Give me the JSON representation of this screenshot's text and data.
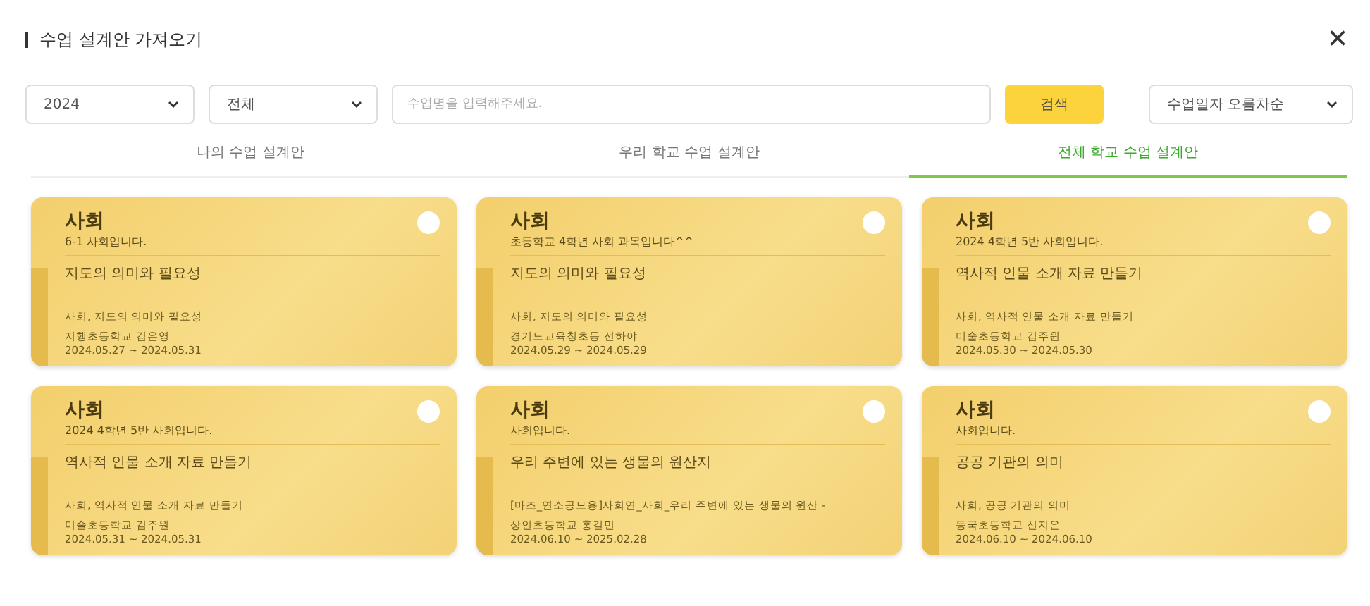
{
  "dialog": {
    "title": "수업 설계안 가져오기",
    "close": "×"
  },
  "filters": {
    "year": "2024",
    "category": "전체",
    "search": {
      "placeholder": "수업명을 입력해주세요."
    },
    "search_button": "검색",
    "sort": "수업일자 오름차순"
  },
  "tabs": [
    {
      "label": "나의 수업 설계안",
      "selected": false
    },
    {
      "label": "우리 학교 수업 설계안",
      "selected": false
    },
    {
      "label": "전체 학교 수업 설계안",
      "selected": true
    }
  ],
  "cards": [
    {
      "subject": "사회",
      "description": "6-1 사회입니다.",
      "lesson": "지도의 의미와 필요성",
      "tags": "사회, 지도의 의미와 필요성",
      "author": "지행초등학교 김은영",
      "period": "2024.05.27 ~ 2024.05.31",
      "selected": false
    },
    {
      "subject": "사회",
      "description": "초등학교 4학년 사회 과목입니다^^",
      "lesson": "지도의 의미와 필요성",
      "tags": "사회, 지도의 의미와 필요성",
      "author": "경기도교육청초등 선하야",
      "period": "2024.05.29 ~ 2024.05.29",
      "selected": false
    },
    {
      "subject": "사회",
      "description": "2024 4학년 5반 사회입니다.",
      "lesson": "역사적 인물 소개 자료 만들기",
      "tags": "사회, 역사적 인물 소개 자료 만들기",
      "author": "미술초등학교 김주원",
      "period": "2024.05.30 ~ 2024.05.30",
      "selected": false
    },
    {
      "subject": "사회",
      "description": "2024 4학년 5반 사회입니다.",
      "lesson": "역사적 인물 소개 자료 만들기",
      "tags": "사회, 역사적 인물 소개 자료 만들기",
      "author": "미술초등학교 김주원",
      "period": "2024.05.31 ~ 2024.05.31",
      "selected": false
    },
    {
      "subject": "사회",
      "description": "사회입니다.",
      "lesson": "우리 주변에 있는 생물의 원산지",
      "tags": "[마조_연소공모용]사회연_사회_우리 주변에 있는 생물의 원산 -",
      "author": "상인초등학교 홍길민",
      "period": "2024.06.10 ~ 2025.02.28",
      "selected": false
    },
    {
      "subject": "사회",
      "description": "사회입니다.",
      "lesson": "공공 기관의 의미",
      "tags": "사회, 공공 기관의 의미",
      "author": "동국초등학교 신지은",
      "period": "2024.06.10 ~ 2024.06.10",
      "selected": false
    }
  ]
}
